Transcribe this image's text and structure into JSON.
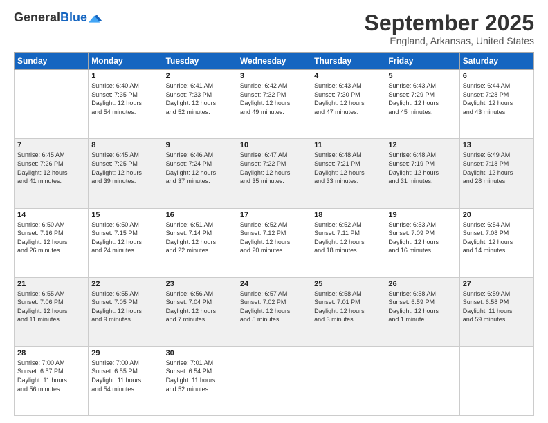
{
  "logo": {
    "general": "General",
    "blue": "Blue"
  },
  "header": {
    "month": "September 2025",
    "location": "England, Arkansas, United States"
  },
  "days_of_week": [
    "Sunday",
    "Monday",
    "Tuesday",
    "Wednesday",
    "Thursday",
    "Friday",
    "Saturday"
  ],
  "weeks": [
    [
      {
        "day": "",
        "info": ""
      },
      {
        "day": "1",
        "info": "Sunrise: 6:40 AM\nSunset: 7:35 PM\nDaylight: 12 hours\nand 54 minutes."
      },
      {
        "day": "2",
        "info": "Sunrise: 6:41 AM\nSunset: 7:33 PM\nDaylight: 12 hours\nand 52 minutes."
      },
      {
        "day": "3",
        "info": "Sunrise: 6:42 AM\nSunset: 7:32 PM\nDaylight: 12 hours\nand 49 minutes."
      },
      {
        "day": "4",
        "info": "Sunrise: 6:43 AM\nSunset: 7:30 PM\nDaylight: 12 hours\nand 47 minutes."
      },
      {
        "day": "5",
        "info": "Sunrise: 6:43 AM\nSunset: 7:29 PM\nDaylight: 12 hours\nand 45 minutes."
      },
      {
        "day": "6",
        "info": "Sunrise: 6:44 AM\nSunset: 7:28 PM\nDaylight: 12 hours\nand 43 minutes."
      }
    ],
    [
      {
        "day": "7",
        "info": "Sunrise: 6:45 AM\nSunset: 7:26 PM\nDaylight: 12 hours\nand 41 minutes."
      },
      {
        "day": "8",
        "info": "Sunrise: 6:45 AM\nSunset: 7:25 PM\nDaylight: 12 hours\nand 39 minutes."
      },
      {
        "day": "9",
        "info": "Sunrise: 6:46 AM\nSunset: 7:24 PM\nDaylight: 12 hours\nand 37 minutes."
      },
      {
        "day": "10",
        "info": "Sunrise: 6:47 AM\nSunset: 7:22 PM\nDaylight: 12 hours\nand 35 minutes."
      },
      {
        "day": "11",
        "info": "Sunrise: 6:48 AM\nSunset: 7:21 PM\nDaylight: 12 hours\nand 33 minutes."
      },
      {
        "day": "12",
        "info": "Sunrise: 6:48 AM\nSunset: 7:19 PM\nDaylight: 12 hours\nand 31 minutes."
      },
      {
        "day": "13",
        "info": "Sunrise: 6:49 AM\nSunset: 7:18 PM\nDaylight: 12 hours\nand 28 minutes."
      }
    ],
    [
      {
        "day": "14",
        "info": "Sunrise: 6:50 AM\nSunset: 7:16 PM\nDaylight: 12 hours\nand 26 minutes."
      },
      {
        "day": "15",
        "info": "Sunrise: 6:50 AM\nSunset: 7:15 PM\nDaylight: 12 hours\nand 24 minutes."
      },
      {
        "day": "16",
        "info": "Sunrise: 6:51 AM\nSunset: 7:14 PM\nDaylight: 12 hours\nand 22 minutes."
      },
      {
        "day": "17",
        "info": "Sunrise: 6:52 AM\nSunset: 7:12 PM\nDaylight: 12 hours\nand 20 minutes."
      },
      {
        "day": "18",
        "info": "Sunrise: 6:52 AM\nSunset: 7:11 PM\nDaylight: 12 hours\nand 18 minutes."
      },
      {
        "day": "19",
        "info": "Sunrise: 6:53 AM\nSunset: 7:09 PM\nDaylight: 12 hours\nand 16 minutes."
      },
      {
        "day": "20",
        "info": "Sunrise: 6:54 AM\nSunset: 7:08 PM\nDaylight: 12 hours\nand 14 minutes."
      }
    ],
    [
      {
        "day": "21",
        "info": "Sunrise: 6:55 AM\nSunset: 7:06 PM\nDaylight: 12 hours\nand 11 minutes."
      },
      {
        "day": "22",
        "info": "Sunrise: 6:55 AM\nSunset: 7:05 PM\nDaylight: 12 hours\nand 9 minutes."
      },
      {
        "day": "23",
        "info": "Sunrise: 6:56 AM\nSunset: 7:04 PM\nDaylight: 12 hours\nand 7 minutes."
      },
      {
        "day": "24",
        "info": "Sunrise: 6:57 AM\nSunset: 7:02 PM\nDaylight: 12 hours\nand 5 minutes."
      },
      {
        "day": "25",
        "info": "Sunrise: 6:58 AM\nSunset: 7:01 PM\nDaylight: 12 hours\nand 3 minutes."
      },
      {
        "day": "26",
        "info": "Sunrise: 6:58 AM\nSunset: 6:59 PM\nDaylight: 12 hours\nand 1 minute."
      },
      {
        "day": "27",
        "info": "Sunrise: 6:59 AM\nSunset: 6:58 PM\nDaylight: 11 hours\nand 59 minutes."
      }
    ],
    [
      {
        "day": "28",
        "info": "Sunrise: 7:00 AM\nSunset: 6:57 PM\nDaylight: 11 hours\nand 56 minutes."
      },
      {
        "day": "29",
        "info": "Sunrise: 7:00 AM\nSunset: 6:55 PM\nDaylight: 11 hours\nand 54 minutes."
      },
      {
        "day": "30",
        "info": "Sunrise: 7:01 AM\nSunset: 6:54 PM\nDaylight: 11 hours\nand 52 minutes."
      },
      {
        "day": "",
        "info": ""
      },
      {
        "day": "",
        "info": ""
      },
      {
        "day": "",
        "info": ""
      },
      {
        "day": "",
        "info": ""
      }
    ]
  ]
}
